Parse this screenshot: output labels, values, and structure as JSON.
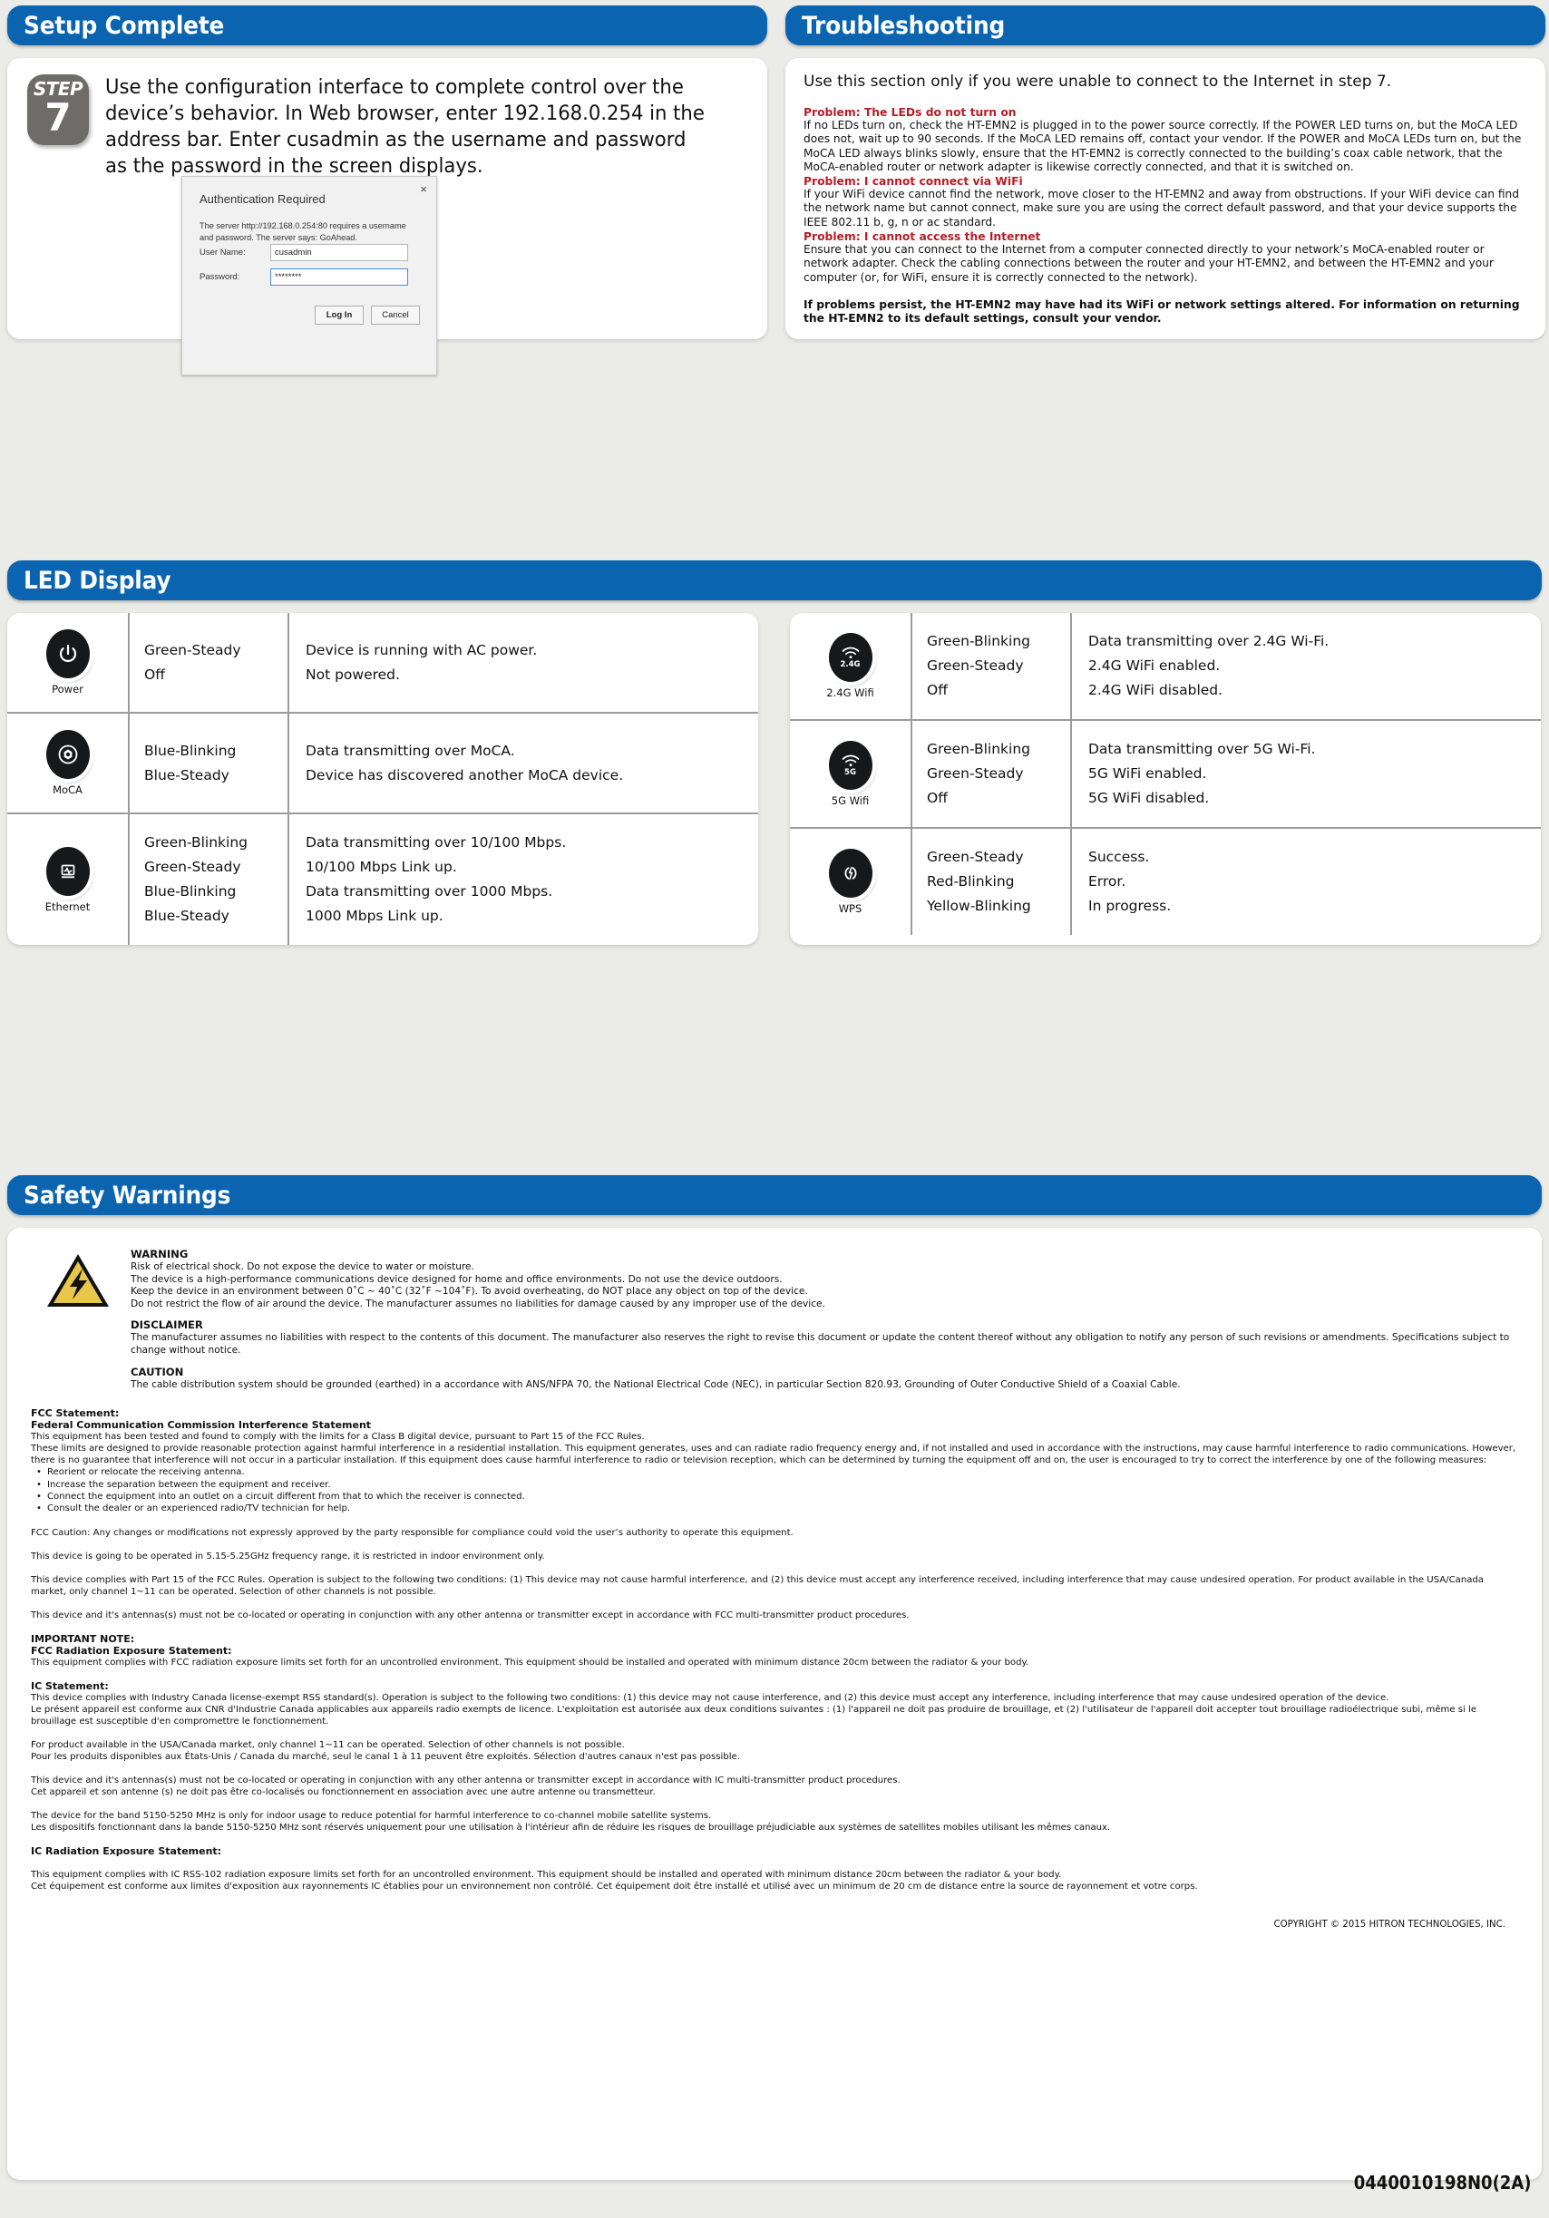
{
  "sections": {
    "setup": {
      "title": "Setup Complete"
    },
    "troubleshooting": {
      "title": "Troubleshooting"
    },
    "led": {
      "title": "LED Display"
    },
    "safety": {
      "title": "Safety Warnings"
    }
  },
  "setup": {
    "step_word": "STEP",
    "step_number": "7",
    "instruction": "Use the configuration interface to complete control over the device’s behavior. In Web browser, enter 192.168.0.254 in the address bar. Enter cusadmin as the username and password as the password in the screen displays."
  },
  "auth_dialog": {
    "title": "Authentication Required",
    "close_label": "×",
    "description": "The server http://192.168.0.254:80 requires a username and password. The server says: GoAhead.",
    "username_label": "User Name:",
    "username_value": "cusadmin",
    "password_label": "Password:",
    "password_value": "********",
    "login_button": "Log In",
    "cancel_button": "Cancel"
  },
  "troubleshooting": {
    "intro": "Use this section only if you were unable to connect to the Internet in step 7.",
    "problems": [
      {
        "heading": "Problem: The LEDs do not turn on",
        "body": "If no LEDs turn on, check the HT-EMN2 is plugged in to the power source correctly. If the POWER LED turns on, but the MoCA LED does not, wait up to 90 seconds. If the MoCA LED remains off, contact your vendor. If the POWER and MoCA LEDs turn on, but the MoCA LED always blinks slowly, ensure that the HT-EMN2 is correctly connected to the building’s coax cable network, that the MoCA-enabled router or network adapter is likewise correctly connected, and that it is switched on."
      },
      {
        "heading": "Problem: I cannot connect via WiFi",
        "body": "If your WiFi device cannot find the network, move closer to the HT-EMN2 and away from obstructions. If your WiFi device can find the network name but cannot connect, make sure you are using the correct default password, and that your device supports the IEEE 802.11 b, g, n or ac standard."
      },
      {
        "heading": "Problem: I cannot access the Internet",
        "body": "Ensure that you can connect to the Internet from a computer connected directly to your network’s MoCA-enabled router or network adapter. Check the cabling connections between the router and your HT-EMN2, and between the HT-EMN2 and your computer (or, for WiFi, ensure it is correctly connected to the network)."
      }
    ],
    "footer": "If problems persist, the HT-EMN2 may have had its WiFi or network settings altered. For information on returning the HT-EMN2 to its default settings, consult your vendor."
  },
  "led_table_left": [
    {
      "icon": "power-icon",
      "name": "Power",
      "states": [
        "Green-Steady",
        "Off"
      ],
      "descriptions": [
        "Device is running with AC power.",
        "Not powered."
      ]
    },
    {
      "icon": "moca-icon",
      "name": "MoCA",
      "states": [
        "Blue-Blinking",
        "Blue-Steady"
      ],
      "descriptions": [
        "Data transmitting over MoCA.",
        "Device has discovered another MoCA device."
      ]
    },
    {
      "icon": "ethernet-icon",
      "name": "Ethernet",
      "states": [
        "Green-Blinking",
        "Green-Steady",
        "Blue-Blinking",
        "Blue-Steady"
      ],
      "descriptions": [
        "Data transmitting over 10/100 Mbps.",
        "10/100 Mbps Link up.",
        "Data transmitting over 1000 Mbps.",
        "1000 Mbps Link up."
      ]
    }
  ],
  "led_table_right": [
    {
      "icon": "wifi-24g-icon",
      "icon_label": "2.4G",
      "name": "2.4G Wifi",
      "states": [
        "Green-Blinking",
        "Green-Steady",
        "Off"
      ],
      "descriptions": [
        "Data transmitting over 2.4G Wi-Fi.",
        "2.4G WiFi enabled.",
        "2.4G WiFi disabled."
      ]
    },
    {
      "icon": "wifi-5g-icon",
      "icon_label": "5G",
      "name": "5G Wifi",
      "states": [
        "Green-Blinking",
        "Green-Steady",
        "Off"
      ],
      "descriptions": [
        "Data transmitting over 5G Wi-Fi.",
        "5G WiFi enabled.",
        "5G WiFi disabled."
      ]
    },
    {
      "icon": "wps-icon",
      "icon_label": "",
      "name": "WPS",
      "states": [
        "Green-Steady",
        "Red-Blinking",
        "Yellow-Blinking"
      ],
      "descriptions": [
        "Success.",
        "Error.",
        "In progress."
      ]
    }
  ],
  "safety": {
    "warning_heading": "WARNING",
    "warning_lines": [
      "Risk of electrical shock. Do not expose the device to water or moisture.",
      "The device is a high-performance communications device designed for home and office environments. Do not use the device outdoors.",
      "Keep the device in an environment between 0˚C ~ 40˚C (32˚F ~104˚F). To avoid overheating, do NOT place any object on top of the device.",
      "Do not restrict the flow of air around the device. The manufacturer assumes no liabilities for damage caused by any improper use of the device."
    ],
    "disclaimer_heading": "DISCLAIMER",
    "disclaimer_text": "The manufacturer assumes no liabilities with respect to the contents of this document. The manufacturer also reserves the right to revise this document or update the content thereof without any obligation to notify any person of such revisions or amendments. Specifications subject to change without notice.",
    "caution_heading": "CAUTION",
    "caution_text": "The cable distribution system should be grounded (earthed) in a accordance with ANS/NFPA 70, the National Electrical Code (NEC), in particular Section 820.93, Grounding of Outer Conductive Shield of a Coaxial Cable."
  },
  "legal": {
    "fcc_statement_heading": "FCC Statement:",
    "fcc_interference_heading": "Federal Communication Commission Interference Statement",
    "fcc_body": "This equipment has been tested and found to comply with the limits for a Class B digital device,  pursuant to Part 15 of the FCC Rules.\nThese limits are designed to provide reasonable protection against harmful interference in a residential installation. This equipment generates, uses and can radiate radio frequency energy and, if not installed and used in accordance with the instructions, may cause harmful interference to radio communications. However, there is no guarantee that interference will not occur in a particular installation. If this equipment does cause harmful interference to radio or television reception, which can be determined by turning the equipment off and on, the user is encouraged to try to correct the interference by one of the following measures:",
    "bullets": [
      "Reorient or relocate the receiving antenna.",
      "Increase the separation between the equipment and receiver.",
      "Connect the equipment into an outlet on a circuit different from that to which the receiver is connected.",
      "Consult the dealer or an experienced radio/TV technician for help."
    ],
    "fcc_caution": "FCC Caution: Any changes or modifications not expressly approved by the party responsible for compliance could void the user’s authority to operate this equipment.",
    "fcc_5ghz": "This device is going to be operated in 5.15-5.25GHz frequency range, it is restricted in indoor environment only.",
    "fcc_part15": "This device complies with Part 15 of the FCC Rules. Operation is subject to the following two conditions: (1) This device may not cause harmful interference, and (2) this device must accept any interference received, including interference that may cause undesired operation. For product available in the USA/Canada market, only channel 1~11 can be operated. Selection of other channels is not possible.",
    "fcc_colocate": "This device and it's antennas(s) must not be co-located or operating in conjunction with any other antenna or transmitter except in accordance with FCC multi-transmitter product procedures.",
    "important_note_heading": "IMPORTANT NOTE:",
    "fcc_radiation_heading": "FCC Radiation Exposure Statement:",
    "fcc_radiation_body": "This equipment complies with FCC radiation exposure limits set forth for an uncontrolled environment. This equipment should be installed and operated with minimum distance 20cm between the radiator & your body.",
    "ic_statement_heading": "IC Statement:",
    "ic_body_en": "This device complies with Industry Canada license-exempt RSS standard(s). Operation is subject to the following two conditions: (1) this device may not cause interference, and (2) this device must accept any interference, including interference that may cause undesired operation of the device.",
    "ic_body_fr": "Le présent appareil est conforme aux CNR d'Industrie Canada applicables aux appareils radio exempts de licence. L'exploitation est autorisée aux deux conditions suivantes : (1) l'appareil ne doit pas produire de brouillage, et (2) l'utilisateur de l'appareil doit accepter tout brouillage radioélectrique subi, même si le brouillage est susceptible d'en compromettre le fonctionnement.",
    "ic_channel_en": "For product available in the USA/Canada market, only channel 1~11 can be operated. Selection of other channels is not possible.",
    "ic_channel_fr": "Pour les produits disponibles aux États-Unis / Canada du marché, seul le canal 1 à 11 peuvent être exploités. Sélection d'autres canaux n'est pas possible.",
    "ic_colocate_en": "This device and it's antennas(s) must not be co-located or operating in conjunction with any other antenna or transmitter except in accordance with IC multi-transmitter product procedures.",
    "ic_colocate_fr": "Cet appareil et son antenne (s) ne doit pas être co-localisés ou fonctionnement en association avec une autre antenne ou transmetteur.",
    "ic_band_en": "The device for the band 5150-5250 MHz is only for indoor usage to reduce potential for harmful interference to co-channel mobile satellite systems.",
    "ic_band_fr": "Les dispositifs fonctionnant dans la bande 5150-5250 MHz sont réservés uniquement pour une utilisation à l'intérieur afin de réduire les risques de brouillage préjudiciable aux systèmes de satellites mobiles utilisant les mêmes canaux.",
    "ic_radiation_heading": "IC Radiation Exposure Statement:",
    "ic_radiation_en": "This equipment complies with IC RSS-102 radiation exposure limits set forth for an uncontrolled environment. This equipment should be installed and operated with minimum distance 20cm between the radiator & your body.",
    "ic_radiation_fr": "Cet équipement est conforme aux limites d'exposition aux rayonnements IC établies pour un environnement non contrôlé. Cet équipement doit être installé et utilisé avec un minimum de 20 cm de distance entre la source de rayonnement et votre corps."
  },
  "footer": {
    "copyright": "COPYRIGHT © 2015 HITRON TECHNOLOGIES, INC.",
    "doc_number": "0440010198N0(2A)"
  },
  "colors": {
    "banner_blue": "#0a64b0",
    "problem_red": "#b91c26",
    "step_badge_gray": "#6e6c68",
    "led_black": "#17181a",
    "warning_yellow": "#e8c84b"
  }
}
